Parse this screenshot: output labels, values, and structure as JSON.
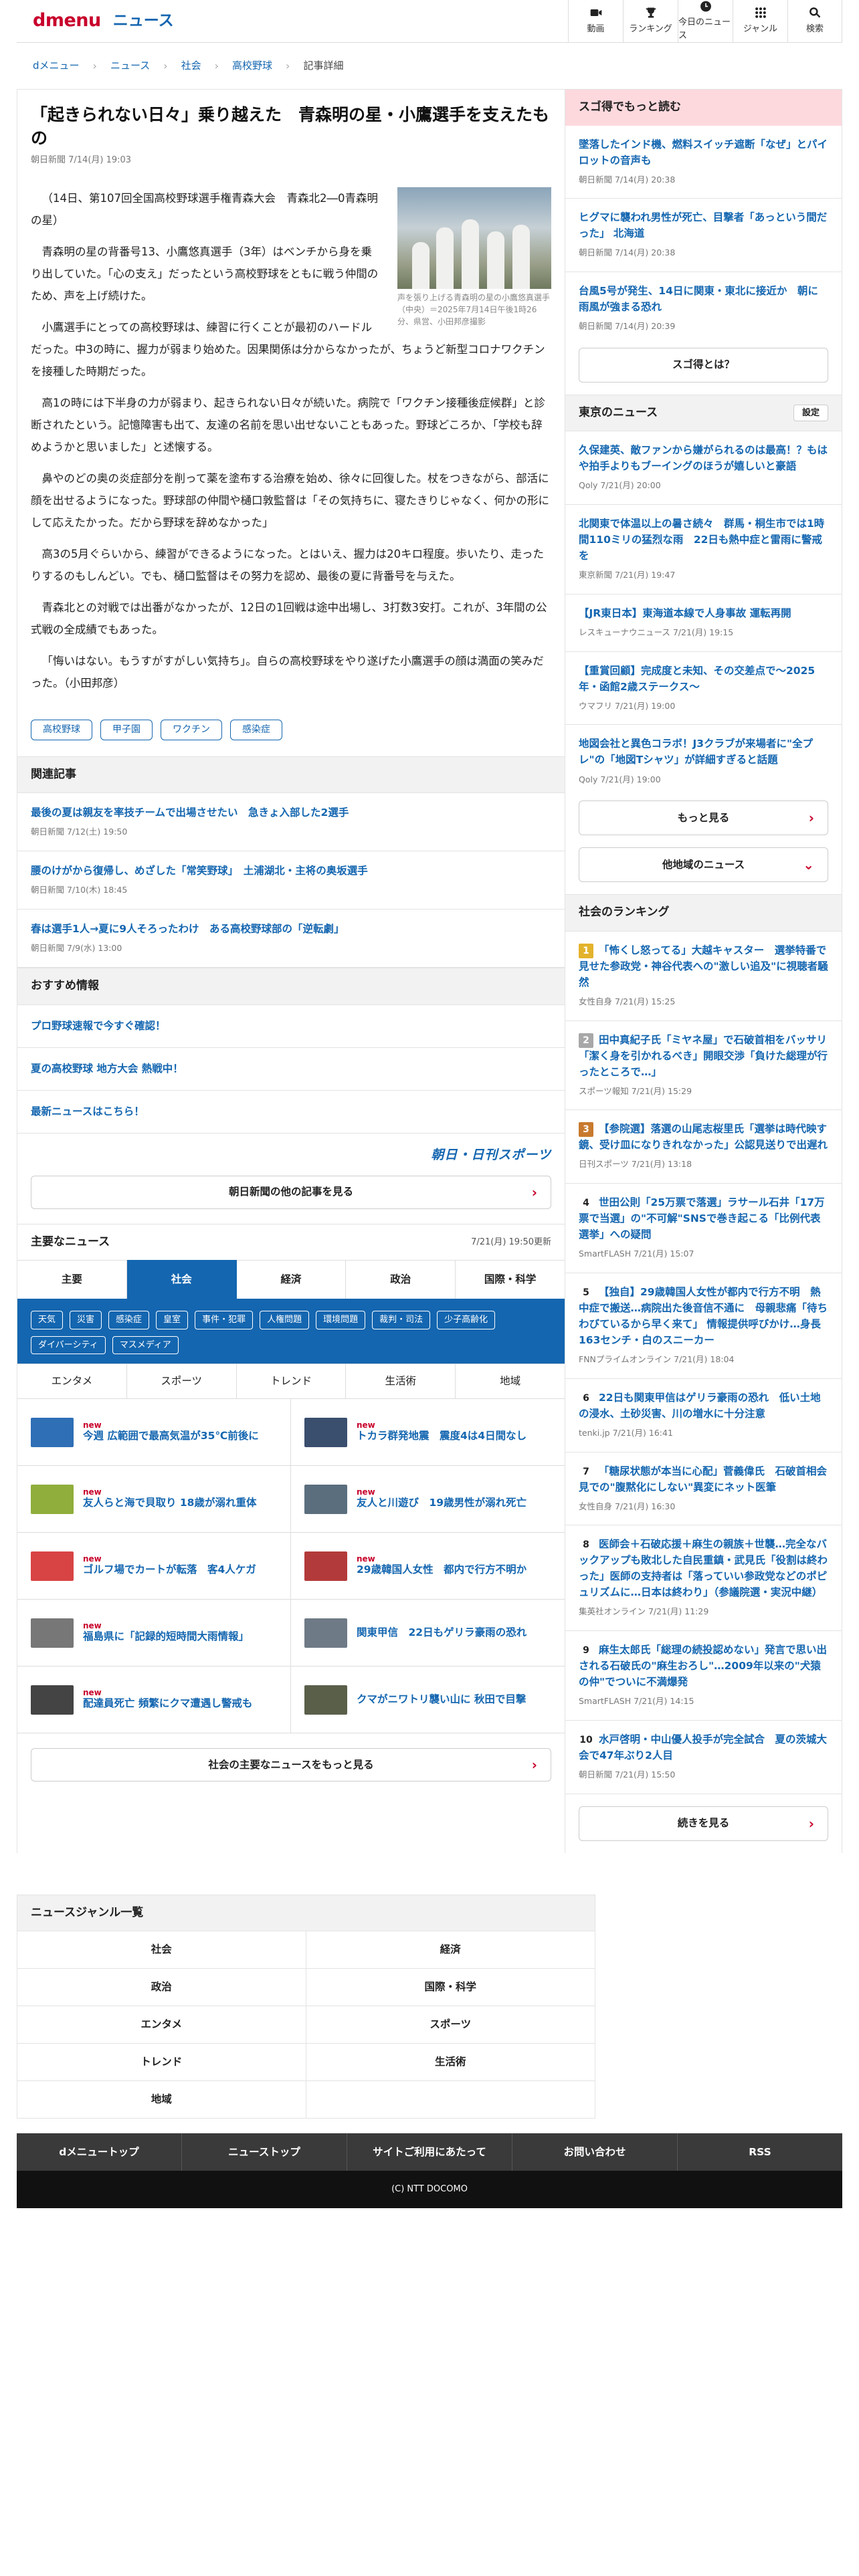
{
  "header": {
    "logo_brand": "dmenu",
    "logo_section": "ニュース",
    "nav": [
      {
        "label": "動画",
        "icon": "video-icon"
      },
      {
        "label": "ランキング",
        "icon": "trophy-icon"
      },
      {
        "label": "今日のニュース",
        "icon": "clock-icon"
      },
      {
        "label": "ジャンル",
        "icon": "grid-icon"
      },
      {
        "label": "検索",
        "icon": "search-icon"
      }
    ]
  },
  "breadcrumb": [
    "dメニュー",
    "ニュース",
    "社会",
    "高校野球",
    "記事詳細"
  ],
  "article": {
    "title": "「起きられない日々」乗り越えた　青森明の星・小鷹選手を支えたもの",
    "meta": "朝日新聞 7/14(月) 19:03",
    "photo_caption": "声を張り上げる青森明の星の小鷹悠真選手（中央）＝2025年7月14日午後1時26分、県営、小田邦彦撮影",
    "paragraphs": [
      "（14日、第107回全国高校野球選手権青森大会　青森北2―0青森明の星）",
      "青森明の星の背番号13、小鷹悠真選手（3年）はベンチから身を乗り出していた。「心の支え」だったという高校野球をともに戦う仲間のため、声を上げ続けた。",
      "小鷹選手にとっての高校野球は、練習に行くことが最初のハードルだった。中3の時に、握力が弱まり始めた。因果関係は分からなかったが、ちょうど新型コロナワクチンを接種した時期だった。",
      "高1の時には下半身の力が弱まり、起きられない日々が続いた。病院で「ワクチン接種後症候群」と診断されたという。記憶障害も出て、友達の名前を思い出せないこともあった。野球どころか、「学校も辞めようかと思いました」と述懐する。",
      "鼻やのどの奥の炎症部分を削って薬を塗布する治療を始め、徐々に回復した。杖をつきながら、部活に顔を出せるようになった。野球部の仲間や樋口敦監督は「その気持ちに、寝たきりじゃなく、何かの形にして応えたかった。だから野球を辞めなかった」",
      "高3の5月ぐらいから、練習ができるようになった。とはいえ、握力は20キロ程度。歩いたり、走ったりするのもしんどい。でも、樋口監督はその努力を認め、最後の夏に背番号を与えた。",
      "青森北との対戦では出番がなかったが、12日の1回戦は途中出場し、3打数3安打。これが、3年間の公式戦の全成績でもあった。",
      "「悔いはない。もうすがすがしい気持ち」。自らの高校野球をやり遂げた小鷹選手の顔は満面の笑みだった。（小田邦彦）"
    ],
    "tags": [
      "高校野球",
      "甲子園",
      "ワクチン",
      "感染症"
    ]
  },
  "related": {
    "heading": "関連記事",
    "items": [
      {
        "title": "最後の夏は親友を率技チームで出場させたい　急きょ入部した2選手",
        "meta": "朝日新聞 7/12(土) 19:50"
      },
      {
        "title": "腰のけがから復帰し、めざした「常笑野球」　土浦湖北・主将の奥坂選手",
        "meta": "朝日新聞 7/10(木) 18:45"
      },
      {
        "title": "春は選手1人→夏に9人そろったわけ　ある高校野球部の「逆転劇」",
        "meta": "朝日新聞 7/9(水) 13:00"
      }
    ]
  },
  "recommended": {
    "heading": "おすすめ情報",
    "items": [
      "プロ野球速報で今すぐ確認！",
      "夏の高校野球 地方大会 熱戦中！",
      "最新ニュースはこちら！"
    ],
    "brand": "朝日・日刊スポーツ",
    "more_button": "朝日新聞の他の記事を見る"
  },
  "main_news": {
    "heading": "主要なニュース",
    "timestamp": "7/21(月) 19:50更新",
    "tabs": [
      "主要",
      "社会",
      "経済",
      "政治",
      "国際・科学"
    ],
    "active_tab": "社会",
    "subtags": [
      "天気",
      "災害",
      "感染症",
      "皇室",
      "事件・犯罪",
      "人権問題",
      "環境問題",
      "裁判・司法",
      "少子高齢化",
      "ダイバーシティ",
      "マスメディア"
    ],
    "tabs2": [
      "エンタメ",
      "スポーツ",
      "トレンド",
      "生活術",
      "地域"
    ],
    "new_label": "new",
    "items": [
      {
        "title": "今週 広範囲で最高気温が35℃前後に",
        "new": true,
        "color": "#2f6fb6"
      },
      {
        "title": "トカラ群発地震　震度4は4日間なし",
        "new": true,
        "color": "#3a4e6e"
      },
      {
        "title": "友人らと海で貝取り 18歳が溺れ重体",
        "new": true,
        "color": "#8fae3c"
      },
      {
        "title": "友人と川遊び　19歳男性が溺れ死亡",
        "new": true,
        "color": "#5a6e7e"
      },
      {
        "title": "ゴルフ場でカートが転落　客4人ケガ",
        "new": true,
        "color": "#d84444"
      },
      {
        "title": "29歳韓国人女性　都内で行方不明か",
        "new": true,
        "color": "#b33a3a"
      },
      {
        "title": "福島県に「記録的短時間大雨情報」",
        "new": true,
        "color": "#777777"
      },
      {
        "title": "関東甲信　22日もゲリラ豪雨の恐れ",
        "new": false,
        "color": "#6e7a86"
      },
      {
        "title": "配達員死亡 頻繁にクマ遭遇し警戒も",
        "new": true,
        "color": "#444444"
      },
      {
        "title": "クマがニワトリ襲い山に 秋田で目撃",
        "new": false,
        "color": "#5a5f4a"
      }
    ],
    "more_button": "社会の主要なニュースをもっと見る"
  },
  "sidebar": {
    "sugo": {
      "heading": "スゴ得でもっと読む",
      "items": [
        {
          "title": "墜落したインド機、燃料スイッチ遮断「なぜ」とパイロットの音声も",
          "meta": "朝日新聞 7/14(月) 20:38"
        },
        {
          "title": "ヒグマに襲われ男性が死亡、目撃者「あっという間だった」 北海道",
          "meta": "朝日新聞 7/14(月) 20:38"
        },
        {
          "title": "台風5号が発生、14日に関東・東北に接近か　朝に雨風が強まる恐れ",
          "meta": "朝日新聞 7/14(月) 20:39"
        }
      ],
      "button": "スゴ得とは？"
    },
    "tokyo": {
      "heading": "東京のニュース",
      "settings": "設定",
      "items": [
        {
          "title": "久保建英、敵ファンから嫌がられるのは最高！？もはや拍手よりもブーイングのほうが嬉しいと豪語",
          "meta": "Qoly 7/21(月) 20:00"
        },
        {
          "title": "北関東で体温以上の暑さ続々　群馬・桐生市では1時間110ミリの猛烈な雨　22日も熱中症と雷雨に警戒を",
          "meta": "東京新聞 7/21(月) 19:47"
        },
        {
          "title": "【JR東日本】東海道本線で人身事故 運転再開",
          "meta": "レスキューナウニュース 7/21(月) 19:15"
        },
        {
          "title": "【重賞回顧】完成度と未知、その交差点で〜2025年・函館2歳ステークス〜",
          "meta": "ウマフリ 7/21(月) 19:00"
        },
        {
          "title": "地図会社と異色コラボ！J3クラブが来場者に\"全プレ\"の「地図Tシャツ」が詳細すぎると話題",
          "meta": "Qoly 7/21(月) 19:00"
        }
      ],
      "more_button": "もっと見る",
      "region_button": "他地域のニュース"
    },
    "ranking": {
      "heading": "社会のランキング",
      "items": [
        {
          "no": "1",
          "title": "「怖くし怒ってる」大越キャスター　選挙特番で見せた参政党・神谷代表への\"激しい追及\"に視聴者騒然",
          "meta": "女性自身 7/21(月) 15:25"
        },
        {
          "no": "2",
          "title": "田中真紀子氏「ミヤネ屋」で石破首相をバッサリ「潔く身を引かれるべき」開眼交渉「負けた総理が行ったところで…」",
          "meta": "スポーツ報知 7/21(月) 15:29"
        },
        {
          "no": "3",
          "title": "【参院選】落選の山尾志桜里氏「選挙は時代映す鏡、受け皿になりきれなかった」公認見送りで出遅れ",
          "meta": "日刊スポーツ 7/21(月) 13:18"
        },
        {
          "no": "4",
          "title": "世田公則「25万票で落選」ラサール石井「17万票で当選」の\"不可解\"SNSで巻き起こる「比例代表選挙」への疑問",
          "meta": "SmartFLASH 7/21(月) 15:07"
        },
        {
          "no": "5",
          "title": "【独自】29歳韓国人女性が都内で行方不明　熱中症で搬送…病院出た後音信不通に　母親悲痛「待ちわびているから早く来て」 情報提供呼びかけ…身長163センチ・白のスニーカー",
          "meta": "FNNプライムオンライン 7/21(月) 18:04"
        },
        {
          "no": "6",
          "title": "22日も関東甲信はゲリラ豪雨の恐れ　低い土地の浸水、土砂災害、川の増水に十分注意",
          "meta": "tenki.jp 7/21(月) 16:41"
        },
        {
          "no": "7",
          "title": "「糖尿状態が本当に心配」菅義偉氏　石破首相会見での\"腹黙化にしない\"異変にネット医筆",
          "meta": "女性自身 7/21(月) 16:30"
        },
        {
          "no": "8",
          "title": "医師会＋石破応援＋麻生の親族＋世襲…完全なバックアップも敗北した自民重鎮・武見氏「役割は終わった」医師の支持者は「落っていい参政党などのポピュリズムに…日本は終わり」（参議院選・実況中継）",
          "meta": "集英社オンライン 7/21(月) 11:29"
        },
        {
          "no": "9",
          "title": "麻生太郎氏「総理の続投認めない」発言で思い出される石破氏の\"麻生おろし\"…2009年以来の\"犬猿の仲\"でついに不満爆発",
          "meta": "SmartFLASH 7/21(月) 14:15"
        },
        {
          "no": "10",
          "title": "水戸啓明・中山優人投手が完全試合　夏の茨城大会で47年ぶり2人目",
          "meta": "朝日新聞 7/21(月) 15:50"
        }
      ],
      "more_button": "続きを見る"
    }
  },
  "genre": {
    "heading": "ニュースジャンル一覧",
    "items": [
      "社会",
      "経済",
      "政治",
      "国際・科学",
      "エンタメ",
      "スポーツ",
      "トレンド",
      "生活術",
      "地域"
    ]
  },
  "footer": {
    "links": [
      "dメニュートップ",
      "ニューストップ",
      "サイトご利用にあたって",
      "お問い合わせ",
      "RSS"
    ],
    "copyright": "(C) NTT DOCOMO"
  }
}
